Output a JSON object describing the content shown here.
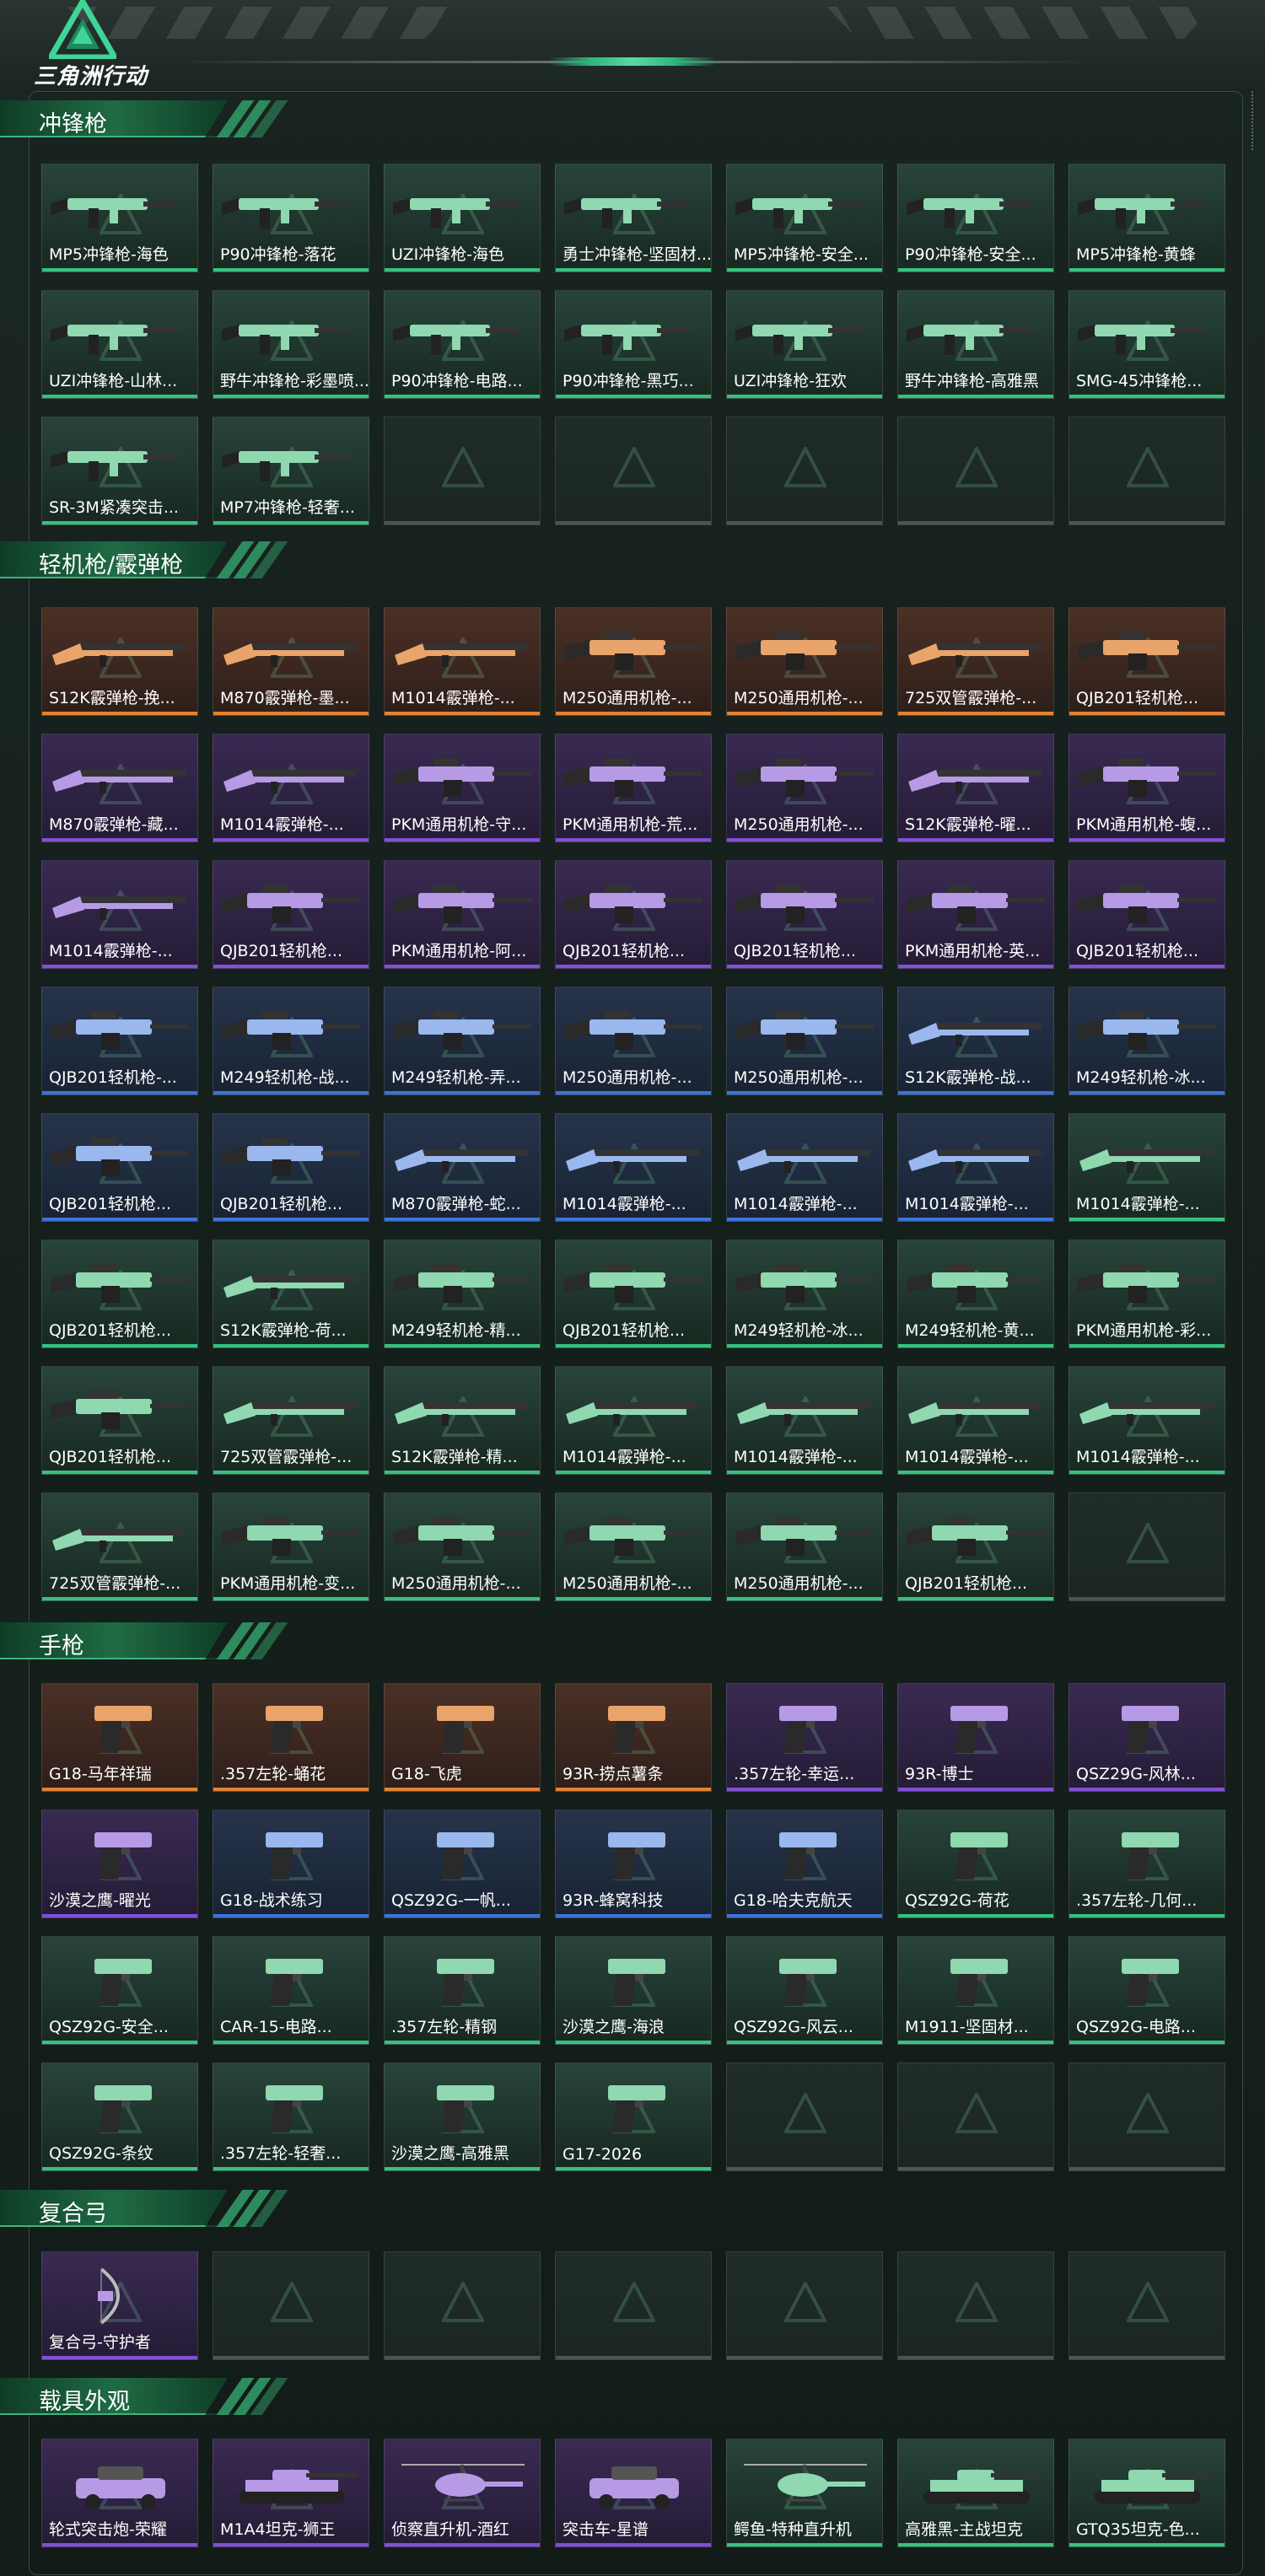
{
  "app": {
    "logo_text": "三角洲行动"
  },
  "colors": {
    "green": "#37c17f",
    "blue": "#3c74d6",
    "purple": "#8150d7",
    "orange": "#e58231",
    "empty": "#4a5652",
    "accent": "#2fb47c"
  },
  "sections": [
    {
      "title": "冲锋枪",
      "items": [
        {
          "name": "MP5冲锋枪-海色",
          "rarity": "green",
          "icon": "smg-icon"
        },
        {
          "name": "P90冲锋枪-落花",
          "rarity": "green",
          "icon": "smg-icon"
        },
        {
          "name": "UZI冲锋枪-海色",
          "rarity": "green",
          "icon": "smg-icon"
        },
        {
          "name": "勇士冲锋枪-坚固材...",
          "rarity": "green",
          "icon": "smg-icon"
        },
        {
          "name": "MP5冲锋枪-安全...",
          "rarity": "green",
          "icon": "smg-icon"
        },
        {
          "name": "P90冲锋枪-安全...",
          "rarity": "green",
          "icon": "smg-icon"
        },
        {
          "name": "MP5冲锋枪-黄蜂",
          "rarity": "green",
          "icon": "smg-icon"
        },
        {
          "name": "UZI冲锋枪-山林...",
          "rarity": "green",
          "icon": "smg-icon"
        },
        {
          "name": "野牛冲锋枪-彩墨喷...",
          "rarity": "green",
          "icon": "smg-icon"
        },
        {
          "name": "P90冲锋枪-电路...",
          "rarity": "green",
          "icon": "smg-icon"
        },
        {
          "name": "P90冲锋枪-黑巧...",
          "rarity": "green",
          "icon": "smg-icon"
        },
        {
          "name": "UZI冲锋枪-狂欢",
          "rarity": "green",
          "icon": "smg-icon"
        },
        {
          "name": "野牛冲锋枪-高雅黑",
          "rarity": "green",
          "icon": "smg-icon"
        },
        {
          "name": "SMG-45冲锋枪...",
          "rarity": "green",
          "icon": "smg-icon"
        },
        {
          "name": "SR-3M紧凑突击...",
          "rarity": "green",
          "icon": "smg-icon"
        },
        {
          "name": "MP7冲锋枪-轻奢...",
          "rarity": "green",
          "icon": "smg-icon"
        },
        {
          "name": "",
          "rarity": "empty"
        },
        {
          "name": "",
          "rarity": "empty"
        },
        {
          "name": "",
          "rarity": "empty"
        },
        {
          "name": "",
          "rarity": "empty"
        },
        {
          "name": "",
          "rarity": "empty"
        }
      ]
    },
    {
      "title": "轻机枪/霰弹枪",
      "items": [
        {
          "name": "S12K霰弹枪-挽...",
          "rarity": "orange",
          "icon": "shotgun-icon"
        },
        {
          "name": "M870霰弹枪-墨...",
          "rarity": "orange",
          "icon": "shotgun-icon"
        },
        {
          "name": "M1014霰弹枪-...",
          "rarity": "orange",
          "icon": "shotgun-icon"
        },
        {
          "name": "M250通用机枪-...",
          "rarity": "orange",
          "icon": "lmg-icon"
        },
        {
          "name": "M250通用机枪-...",
          "rarity": "orange",
          "icon": "lmg-icon"
        },
        {
          "name": "725双管霰弹枪-...",
          "rarity": "orange",
          "icon": "shotgun-icon"
        },
        {
          "name": "QJB201轻机枪...",
          "rarity": "orange",
          "icon": "lmg-icon"
        },
        {
          "name": "M870霰弹枪-藏...",
          "rarity": "purple",
          "icon": "shotgun-icon"
        },
        {
          "name": "M1014霰弹枪-...",
          "rarity": "purple",
          "icon": "shotgun-icon"
        },
        {
          "name": "PKM通用机枪-守...",
          "rarity": "purple",
          "icon": "lmg-icon"
        },
        {
          "name": "PKM通用机枪-荒...",
          "rarity": "purple",
          "icon": "lmg-icon"
        },
        {
          "name": "M250通用机枪-...",
          "rarity": "purple",
          "icon": "lmg-icon"
        },
        {
          "name": "S12K霰弹枪-曜...",
          "rarity": "purple",
          "icon": "shotgun-icon"
        },
        {
          "name": "PKM通用机枪-蝮...",
          "rarity": "purple",
          "icon": "lmg-icon"
        },
        {
          "name": "M1014霰弹枪-...",
          "rarity": "purple",
          "icon": "shotgun-icon"
        },
        {
          "name": "QJB201轻机枪...",
          "rarity": "purple",
          "icon": "lmg-icon"
        },
        {
          "name": "PKM通用机枪-阿...",
          "rarity": "purple",
          "icon": "lmg-icon"
        },
        {
          "name": "QJB201轻机枪...",
          "rarity": "purple",
          "icon": "lmg-icon"
        },
        {
          "name": "QJB201轻机枪...",
          "rarity": "purple",
          "icon": "lmg-icon"
        },
        {
          "name": "PKM通用机枪-英...",
          "rarity": "purple",
          "icon": "lmg-icon"
        },
        {
          "name": "QJB201轻机枪...",
          "rarity": "purple",
          "icon": "lmg-icon"
        },
        {
          "name": "QJB201轻机枪-...",
          "rarity": "blue",
          "icon": "lmg-icon"
        },
        {
          "name": "M249轻机枪-战...",
          "rarity": "blue",
          "icon": "lmg-icon"
        },
        {
          "name": "M249轻机枪-弄...",
          "rarity": "blue",
          "icon": "lmg-icon"
        },
        {
          "name": "M250通用机枪-...",
          "rarity": "blue",
          "icon": "lmg-icon"
        },
        {
          "name": "M250通用机枪-...",
          "rarity": "blue",
          "icon": "lmg-icon"
        },
        {
          "name": "S12K霰弹枪-战...",
          "rarity": "blue",
          "icon": "shotgun-icon"
        },
        {
          "name": "M249轻机枪-冰...",
          "rarity": "blue",
          "icon": "lmg-icon"
        },
        {
          "name": "QJB201轻机枪...",
          "rarity": "blue",
          "icon": "lmg-icon"
        },
        {
          "name": "QJB201轻机枪...",
          "rarity": "blue",
          "icon": "lmg-icon"
        },
        {
          "name": "M870霰弹枪-蛇...",
          "rarity": "blue",
          "icon": "shotgun-icon"
        },
        {
          "name": "M1014霰弹枪-...",
          "rarity": "blue",
          "icon": "shotgun-icon"
        },
        {
          "name": "M1014霰弹枪-...",
          "rarity": "blue",
          "icon": "shotgun-icon"
        },
        {
          "name": "M1014霰弹枪-...",
          "rarity": "blue",
          "icon": "shotgun-icon"
        },
        {
          "name": "M1014霰弹枪-...",
          "rarity": "green",
          "icon": "shotgun-icon"
        },
        {
          "name": "QJB201轻机枪...",
          "rarity": "green",
          "icon": "lmg-icon"
        },
        {
          "name": "S12K霰弹枪-荷...",
          "rarity": "green",
          "icon": "shotgun-icon"
        },
        {
          "name": "M249轻机枪-精...",
          "rarity": "green",
          "icon": "lmg-icon"
        },
        {
          "name": "QJB201轻机枪...",
          "rarity": "green",
          "icon": "lmg-icon"
        },
        {
          "name": "M249轻机枪-冰...",
          "rarity": "green",
          "icon": "lmg-icon"
        },
        {
          "name": "M249轻机枪-黄...",
          "rarity": "green",
          "icon": "lmg-icon"
        },
        {
          "name": "PKM通用机枪-彩...",
          "rarity": "green",
          "icon": "lmg-icon"
        },
        {
          "name": "QJB201轻机枪...",
          "rarity": "green",
          "icon": "lmg-icon"
        },
        {
          "name": "725双管霰弹枪-...",
          "rarity": "green",
          "icon": "shotgun-icon"
        },
        {
          "name": "S12K霰弹枪-精...",
          "rarity": "green",
          "icon": "shotgun-icon"
        },
        {
          "name": "M1014霰弹枪-...",
          "rarity": "green",
          "icon": "shotgun-icon"
        },
        {
          "name": "M1014霰弹枪-...",
          "rarity": "green",
          "icon": "shotgun-icon"
        },
        {
          "name": "M1014霰弹枪-...",
          "rarity": "green",
          "icon": "shotgun-icon"
        },
        {
          "name": "M1014霰弹枪-...",
          "rarity": "green",
          "icon": "shotgun-icon"
        },
        {
          "name": "725双管霰弹枪-...",
          "rarity": "green",
          "icon": "shotgun-icon"
        },
        {
          "name": "PKM通用机枪-变...",
          "rarity": "green",
          "icon": "lmg-icon"
        },
        {
          "name": "M250通用机枪-...",
          "rarity": "green",
          "icon": "lmg-icon"
        },
        {
          "name": "M250通用机枪-...",
          "rarity": "green",
          "icon": "lmg-icon"
        },
        {
          "name": "M250通用机枪-...",
          "rarity": "green",
          "icon": "lmg-icon"
        },
        {
          "name": "QJB201轻机枪...",
          "rarity": "green",
          "icon": "lmg-icon"
        },
        {
          "name": "",
          "rarity": "empty"
        }
      ]
    },
    {
      "title": "手枪",
      "items": [
        {
          "name": "G18-马年祥瑞",
          "rarity": "orange",
          "icon": "pistol-icon"
        },
        {
          "name": ".357左轮-蛹花",
          "rarity": "orange",
          "icon": "pistol-icon"
        },
        {
          "name": "G18-飞虎",
          "rarity": "orange",
          "icon": "pistol-icon"
        },
        {
          "name": "93R-捞点薯条",
          "rarity": "orange",
          "icon": "pistol-icon"
        },
        {
          "name": ".357左轮-幸运...",
          "rarity": "purple",
          "icon": "pistol-icon"
        },
        {
          "name": "93R-博士",
          "rarity": "purple",
          "icon": "pistol-icon"
        },
        {
          "name": "QSZ29G-风林...",
          "rarity": "purple",
          "icon": "pistol-icon"
        },
        {
          "name": "沙漠之鹰-曜光",
          "rarity": "purple",
          "icon": "pistol-icon"
        },
        {
          "name": "G18-战术练习",
          "rarity": "blue",
          "icon": "pistol-icon"
        },
        {
          "name": "QSZ92G-一帆...",
          "rarity": "blue",
          "icon": "pistol-icon"
        },
        {
          "name": "93R-蜂窝科技",
          "rarity": "blue",
          "icon": "pistol-icon"
        },
        {
          "name": "G18-哈夫克航天",
          "rarity": "blue",
          "icon": "pistol-icon"
        },
        {
          "name": "QSZ92G-荷花",
          "rarity": "green",
          "icon": "pistol-icon"
        },
        {
          "name": ".357左轮-几何...",
          "rarity": "green",
          "icon": "pistol-icon"
        },
        {
          "name": "QSZ92G-安全...",
          "rarity": "green",
          "icon": "pistol-icon"
        },
        {
          "name": "CAR-15-电路...",
          "rarity": "green",
          "icon": "pistol-icon"
        },
        {
          "name": ".357左轮-精钢",
          "rarity": "green",
          "icon": "pistol-icon"
        },
        {
          "name": "沙漠之鹰-海浪",
          "rarity": "green",
          "icon": "pistol-icon"
        },
        {
          "name": "QSZ92G-风云...",
          "rarity": "green",
          "icon": "pistol-icon"
        },
        {
          "name": "M1911-坚固材...",
          "rarity": "green",
          "icon": "pistol-icon"
        },
        {
          "name": "QSZ92G-电路...",
          "rarity": "green",
          "icon": "pistol-icon"
        },
        {
          "name": "QSZ92G-条纹",
          "rarity": "green",
          "icon": "pistol-icon"
        },
        {
          "name": ".357左轮-轻奢...",
          "rarity": "green",
          "icon": "pistol-icon"
        },
        {
          "name": "沙漠之鹰-高雅黑",
          "rarity": "green",
          "icon": "pistol-icon"
        },
        {
          "name": "G17-2026",
          "rarity": "green",
          "icon": "pistol-icon"
        },
        {
          "name": "",
          "rarity": "empty"
        },
        {
          "name": "",
          "rarity": "empty"
        },
        {
          "name": "",
          "rarity": "empty"
        }
      ]
    },
    {
      "title": "复合弓",
      "items": [
        {
          "name": "复合弓-守护者",
          "rarity": "purple",
          "icon": "bow-icon"
        },
        {
          "name": "",
          "rarity": "empty"
        },
        {
          "name": "",
          "rarity": "empty"
        },
        {
          "name": "",
          "rarity": "empty"
        },
        {
          "name": "",
          "rarity": "empty"
        },
        {
          "name": "",
          "rarity": "empty"
        },
        {
          "name": "",
          "rarity": "empty"
        }
      ]
    },
    {
      "title": "载具外观",
      "items": [
        {
          "name": "轮式突击炮-荣耀",
          "rarity": "purple",
          "icon": "vehicle-icon"
        },
        {
          "name": "M1A4坦克-狮王",
          "rarity": "purple",
          "icon": "tank-icon"
        },
        {
          "name": "侦察直升机-酒红",
          "rarity": "purple",
          "icon": "helicopter-icon"
        },
        {
          "name": "突击车-星谱",
          "rarity": "purple",
          "icon": "vehicle-icon"
        },
        {
          "name": "鳄鱼-特种直升机",
          "rarity": "green",
          "icon": "helicopter-icon"
        },
        {
          "name": "高雅黑-主战坦克",
          "rarity": "green",
          "icon": "tank-icon"
        },
        {
          "name": "GTQ35坦克-色...",
          "rarity": "green",
          "icon": "tank-icon"
        }
      ]
    }
  ]
}
